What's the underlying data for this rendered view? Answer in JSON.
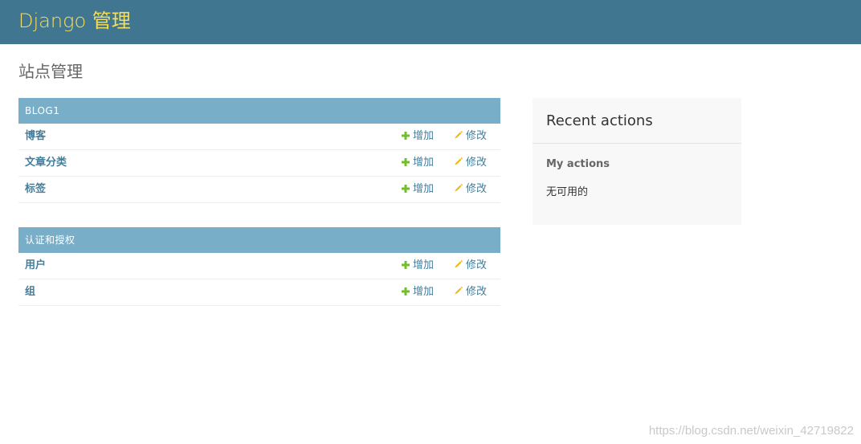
{
  "header": {
    "branding": "Django 管理",
    "background": "#417690",
    "brand_color": "#f5dd5d"
  },
  "page": {
    "title": "站点管理"
  },
  "apps": [
    {
      "caption": "BLOG1",
      "models": [
        {
          "name": "博客",
          "add": "增加",
          "change": "修改"
        },
        {
          "name": "文章分类",
          "add": "增加",
          "change": "修改"
        },
        {
          "name": "标签",
          "add": "增加",
          "change": "修改"
        }
      ]
    },
    {
      "caption": "认证和授权",
      "models": [
        {
          "name": "用户",
          "add": "增加",
          "change": "修改"
        },
        {
          "name": "组",
          "add": "增加",
          "change": "修改"
        }
      ]
    }
  ],
  "recent_actions": {
    "title": "Recent actions",
    "subtitle": "My actions",
    "empty_text": "无可用的"
  },
  "icons": {
    "add": "plus-icon",
    "change": "pencil-icon",
    "add_color": "#70bf2b",
    "change_color": "#efb80b"
  },
  "watermark": "https://blog.csdn.net/weixin_42719822"
}
